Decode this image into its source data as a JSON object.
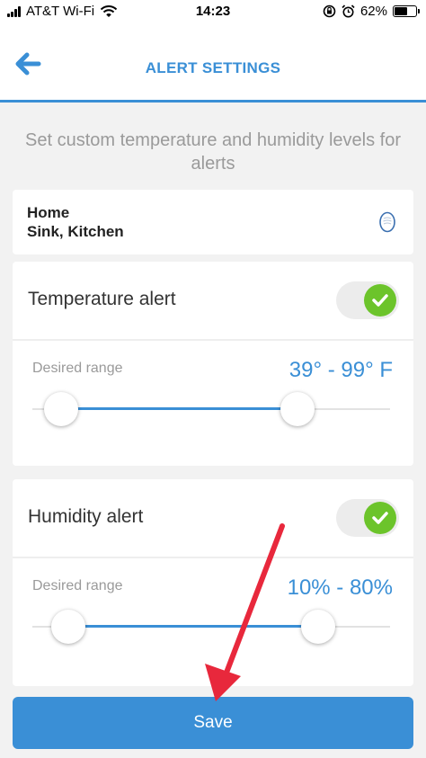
{
  "status_bar": {
    "carrier": "AT&T Wi-Fi",
    "time": "14:23",
    "battery": "62%",
    "battery_level": 0.62
  },
  "header": {
    "title": "ALERT SETTINGS",
    "back_icon": "arrow-left-icon",
    "accent_color": "#3a8fd6"
  },
  "intro_text": "Set custom temperature and humidity levels for alerts",
  "location": {
    "line1": "Home",
    "line2": "Sink, Kitchen",
    "icon": "sensor-icon"
  },
  "temperature": {
    "title": "Temperature alert",
    "enabled": true,
    "range_label": "Desired range",
    "range_value": "39° - 99° F",
    "min_fraction": 0.08,
    "max_fraction": 0.74
  },
  "humidity": {
    "title": "Humidity alert",
    "enabled": true,
    "range_label": "Desired range",
    "range_value": "10% - 80%",
    "min_fraction": 0.1,
    "max_fraction": 0.8
  },
  "save_label": "Save",
  "colors": {
    "toggle_on": "#6cc42b",
    "annotation_arrow": "#e8283c"
  }
}
